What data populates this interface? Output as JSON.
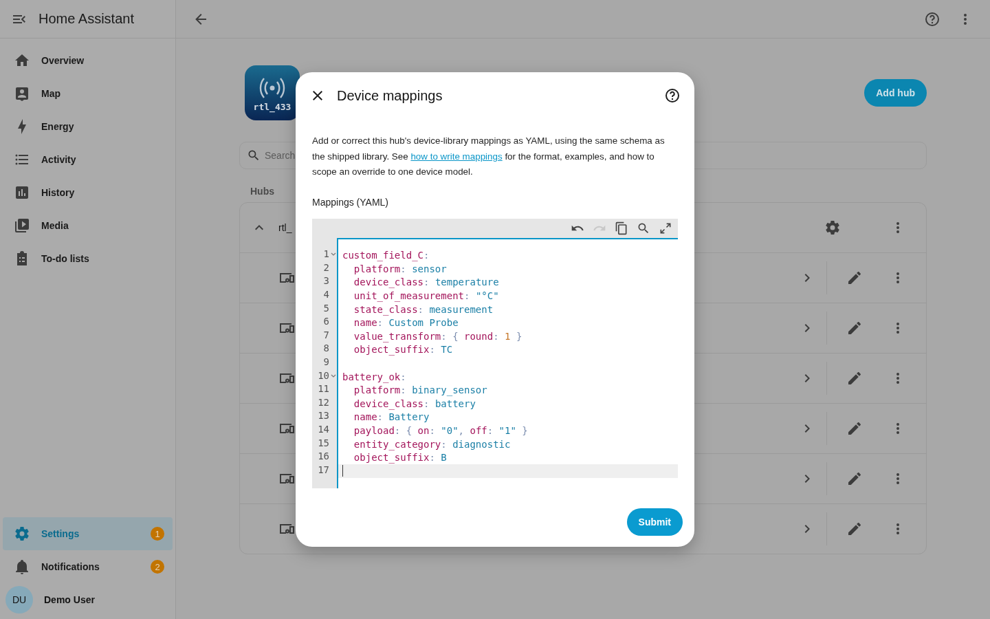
{
  "sidebar": {
    "title": "Home Assistant",
    "items": [
      {
        "label": "Overview",
        "selected": false
      },
      {
        "label": "Map",
        "selected": false
      },
      {
        "label": "Energy",
        "selected": false
      },
      {
        "label": "Activity",
        "selected": false
      },
      {
        "label": "History",
        "selected": false
      },
      {
        "label": "Media",
        "selected": false
      },
      {
        "label": "To-do lists",
        "selected": false
      }
    ],
    "bottom_items": [
      {
        "label": "Settings",
        "selected": true,
        "badge": "1"
      },
      {
        "label": "Notifications",
        "selected": false,
        "badge": "2"
      }
    ],
    "user": {
      "initials": "DU",
      "name": "Demo User"
    }
  },
  "page": {
    "logo_text": "rtl_433",
    "add_button": "Add hub",
    "search": {
      "placeholder": "Search"
    },
    "section": "Hubs",
    "hub": {
      "name": "rtl_",
      "expanded": true
    },
    "device_rows": [
      {
        "kind": "device"
      },
      {
        "kind": "device"
      },
      {
        "kind": "device"
      },
      {
        "kind": "device"
      },
      {
        "kind": "device"
      },
      {
        "kind": "device"
      }
    ]
  },
  "dialog": {
    "title": "Device mappings",
    "description": {
      "before": "Add or correct this hub's device-library mappings as YAML, using the same schema as the shipped library. See ",
      "link": "how to write mappings",
      "after": " for the format, examples, and how to scope an override to one device model."
    },
    "field_label": "Mappings (YAML)",
    "toolbar": [
      {
        "kind": "undo",
        "disabled": false
      },
      {
        "kind": "redo",
        "disabled": true
      },
      {
        "kind": "copy",
        "disabled": false
      },
      {
        "kind": "find",
        "disabled": false
      },
      {
        "kind": "fullscreen",
        "disabled": false
      }
    ],
    "lines": [
      {
        "number": "1",
        "fold": true,
        "tokens": [
          {
            "kind": "key",
            "text": "custom_field_C"
          },
          {
            "kind": "punct",
            "text": ":"
          }
        ]
      },
      {
        "number": "2",
        "tokens": [
          {
            "kind": "key",
            "text": "  platform"
          },
          {
            "kind": "punct",
            "text": ": "
          },
          {
            "kind": "value",
            "text": "sensor"
          }
        ]
      },
      {
        "number": "3",
        "tokens": [
          {
            "kind": "key",
            "text": "  device_class"
          },
          {
            "kind": "punct",
            "text": ": "
          },
          {
            "kind": "value",
            "text": "temperature"
          }
        ]
      },
      {
        "number": "4",
        "tokens": [
          {
            "kind": "key",
            "text": "  unit_of_measurement"
          },
          {
            "kind": "punct",
            "text": ": "
          },
          {
            "kind": "value",
            "text": "\"°C\""
          }
        ]
      },
      {
        "number": "5",
        "tokens": [
          {
            "kind": "key",
            "text": "  state_class"
          },
          {
            "kind": "punct",
            "text": ": "
          },
          {
            "kind": "value",
            "text": "measurement"
          }
        ]
      },
      {
        "number": "6",
        "tokens": [
          {
            "kind": "key",
            "text": "  name"
          },
          {
            "kind": "punct",
            "text": ": "
          },
          {
            "kind": "value",
            "text": "Custom Probe"
          }
        ]
      },
      {
        "number": "7",
        "tokens": [
          {
            "kind": "key",
            "text": "  value_transform"
          },
          {
            "kind": "punct",
            "text": ": { "
          },
          {
            "kind": "key",
            "text": "round"
          },
          {
            "kind": "punct",
            "text": ": "
          },
          {
            "kind": "number",
            "text": "1"
          },
          {
            "kind": "punct",
            "text": " }"
          }
        ]
      },
      {
        "number": "8",
        "tokens": [
          {
            "kind": "key",
            "text": "  object_suffix"
          },
          {
            "kind": "punct",
            "text": ": "
          },
          {
            "kind": "value",
            "text": "TC"
          }
        ]
      },
      {
        "number": "9"
      },
      {
        "number": "10",
        "fold": true,
        "tokens": [
          {
            "kind": "key",
            "text": "battery_ok"
          },
          {
            "kind": "punct",
            "text": ":"
          }
        ]
      },
      {
        "number": "11",
        "tokens": [
          {
            "kind": "key",
            "text": "  platform"
          },
          {
            "kind": "punct",
            "text": ": "
          },
          {
            "kind": "value",
            "text": "binary_sensor"
          }
        ]
      },
      {
        "number": "12",
        "tokens": [
          {
            "kind": "key",
            "text": "  device_class"
          },
          {
            "kind": "punct",
            "text": ": "
          },
          {
            "kind": "value",
            "text": "battery"
          }
        ]
      },
      {
        "number": "13",
        "tokens": [
          {
            "kind": "key",
            "text": "  name"
          },
          {
            "kind": "punct",
            "text": ": "
          },
          {
            "kind": "value",
            "text": "Battery"
          }
        ]
      },
      {
        "number": "14",
        "tokens": [
          {
            "kind": "key",
            "text": "  payload"
          },
          {
            "kind": "punct",
            "text": ": { "
          },
          {
            "kind": "key",
            "text": "on"
          },
          {
            "kind": "punct",
            "text": ": "
          },
          {
            "kind": "value",
            "text": "\"0\""
          },
          {
            "kind": "punct",
            "text": ", "
          },
          {
            "kind": "key",
            "text": "off"
          },
          {
            "kind": "punct",
            "text": ": "
          },
          {
            "kind": "value",
            "text": "\"1\""
          },
          {
            "kind": "punct",
            "text": " }"
          }
        ]
      },
      {
        "number": "15",
        "tokens": [
          {
            "kind": "key",
            "text": "  entity_category"
          },
          {
            "kind": "punct",
            "text": ": "
          },
          {
            "kind": "value",
            "text": "diagnostic"
          }
        ]
      },
      {
        "number": "16",
        "tokens": [
          {
            "kind": "key",
            "text": "  object_suffix"
          },
          {
            "kind": "punct",
            "text": ": "
          },
          {
            "kind": "value",
            "text": "B"
          }
        ]
      },
      {
        "number": "17",
        "current": true
      }
    ],
    "submit": "Submit"
  }
}
